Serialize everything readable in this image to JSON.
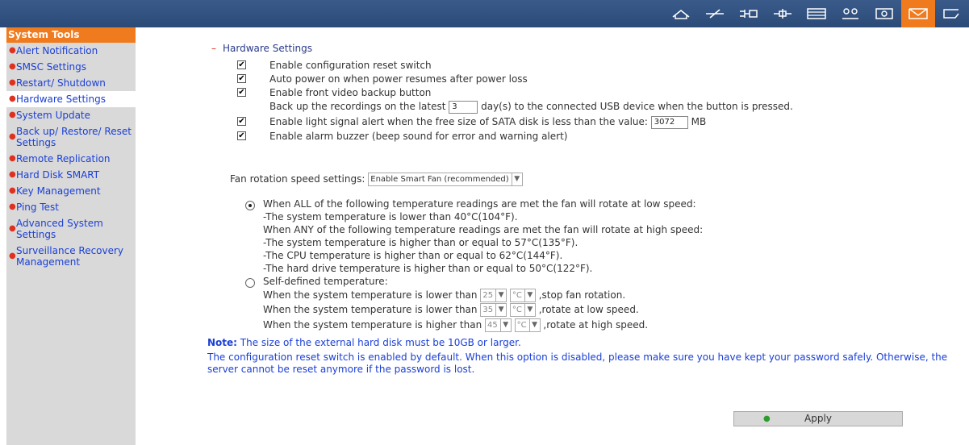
{
  "sidebar": {
    "header": "System Tools",
    "items": [
      {
        "label": "Alert Notification"
      },
      {
        "label": "SMSC Settings"
      },
      {
        "label": "Restart/ Shutdown"
      },
      {
        "label": "Hardware Settings"
      },
      {
        "label": "System Update"
      },
      {
        "label": "Back up/ Restore/ Reset Settings"
      },
      {
        "label": "Remote Replication"
      },
      {
        "label": "Hard Disk SMART"
      },
      {
        "label": "Key Management"
      },
      {
        "label": "Ping Test"
      },
      {
        "label": "Advanced System Settings"
      },
      {
        "label": "Surveillance Recovery Management"
      }
    ]
  },
  "toolbar": {
    "icons": [
      "home-icon",
      "network-icon",
      "connector-icon",
      "plus-icon",
      "monitor-icon",
      "users-icon",
      "disk-icon",
      "mail-icon",
      "export-icon"
    ],
    "active_icon": "mail-icon",
    "active_color": "#f07a1e"
  },
  "main": {
    "section_title": "Hardware Settings",
    "options": {
      "config_reset": "Enable configuration reset switch",
      "auto_power": "Auto power on when power resumes after power loss",
      "front_backup": "Enable front video backup button",
      "backup_pre": "Back up the recordings on the latest",
      "backup_days": "3",
      "backup_post": "day(s) to the connected USB device when the button is pressed.",
      "light_alert_pre": "Enable light signal alert when the free size of SATA disk is less than the value:",
      "light_alert_value": "3072",
      "light_alert_unit": "MB",
      "alarm_buzzer": "Enable alarm buzzer (beep sound for error and warning alert)"
    },
    "fan": {
      "label": "Fan rotation speed settings:",
      "mode": "Enable Smart Fan (recommended)",
      "smart_lines": [
        "When ALL of the following temperature readings are met the fan will rotate at low speed:",
        "-The system temperature is lower than 40°C(104°F).",
        "When ANY of the following temperature readings are met the fan will rotate at high speed:",
        "-The system temperature is higher than or equal to 57°C(135°F).",
        "-The CPU temperature is higher than or equal to 62°C(144°F).",
        "-The hard drive temperature is higher than or equal to 50°C(122°F)."
      ],
      "self_defined_label": "Self-defined temperature:",
      "rules": [
        {
          "pre": "When the system temperature is lower than",
          "value": "25",
          "unit": "°C",
          "post": ",stop fan rotation."
        },
        {
          "pre": "When the system temperature is lower than",
          "value": "35",
          "unit": "°C",
          "post": ",rotate at low speed."
        },
        {
          "pre": "When the system temperature is higher than",
          "value": "45",
          "unit": "°C",
          "post": ",rotate at high speed."
        }
      ]
    },
    "note_label": "Note:",
    "note_text": "The size of the external hard disk must be 10GB or larger.",
    "info_line1": "The configuration reset switch is enabled by default. When this option is disabled, please make sure you have kept your password safely. Otherwise, the",
    "info_line2": "server cannot be reset anymore if the password is lost.",
    "apply_label": "Apply"
  }
}
